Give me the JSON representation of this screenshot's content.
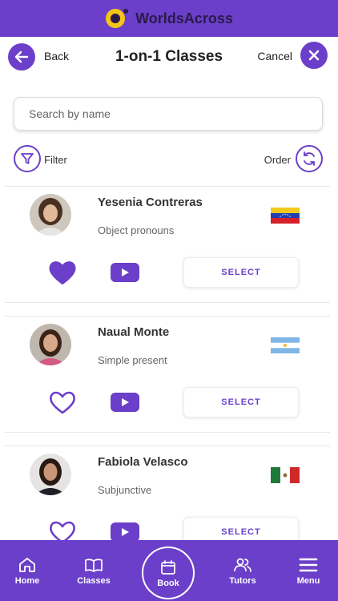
{
  "brand": {
    "name": "WorldsAcross"
  },
  "nav": {
    "back_label": "Back",
    "title": "1-on-1 Classes",
    "cancel_label": "Cancel"
  },
  "search": {
    "placeholder": "Search by name"
  },
  "filters": {
    "filter_label": "Filter",
    "order_label": "Order"
  },
  "tutors": [
    {
      "name": "Yesenia Contreras",
      "topic": "Object pronouns",
      "flag": "venezuela-flag",
      "favorite": true,
      "select_label": "SELECT"
    },
    {
      "name": "Naual Monte",
      "topic": "Simple present",
      "flag": "argentina-flag",
      "favorite": false,
      "select_label": "SELECT"
    },
    {
      "name": "Fabiola Velasco",
      "topic": "Subjunctive",
      "flag": "mexico-flag",
      "favorite": false,
      "select_label": "SELECT"
    }
  ],
  "tabbar": {
    "home": "Home",
    "classes": "Classes",
    "book": "Book",
    "tutors": "Tutors",
    "menu": "Menu"
  },
  "colors": {
    "accent": "#6b3fc9",
    "brand_yellow": "#f5c518"
  }
}
